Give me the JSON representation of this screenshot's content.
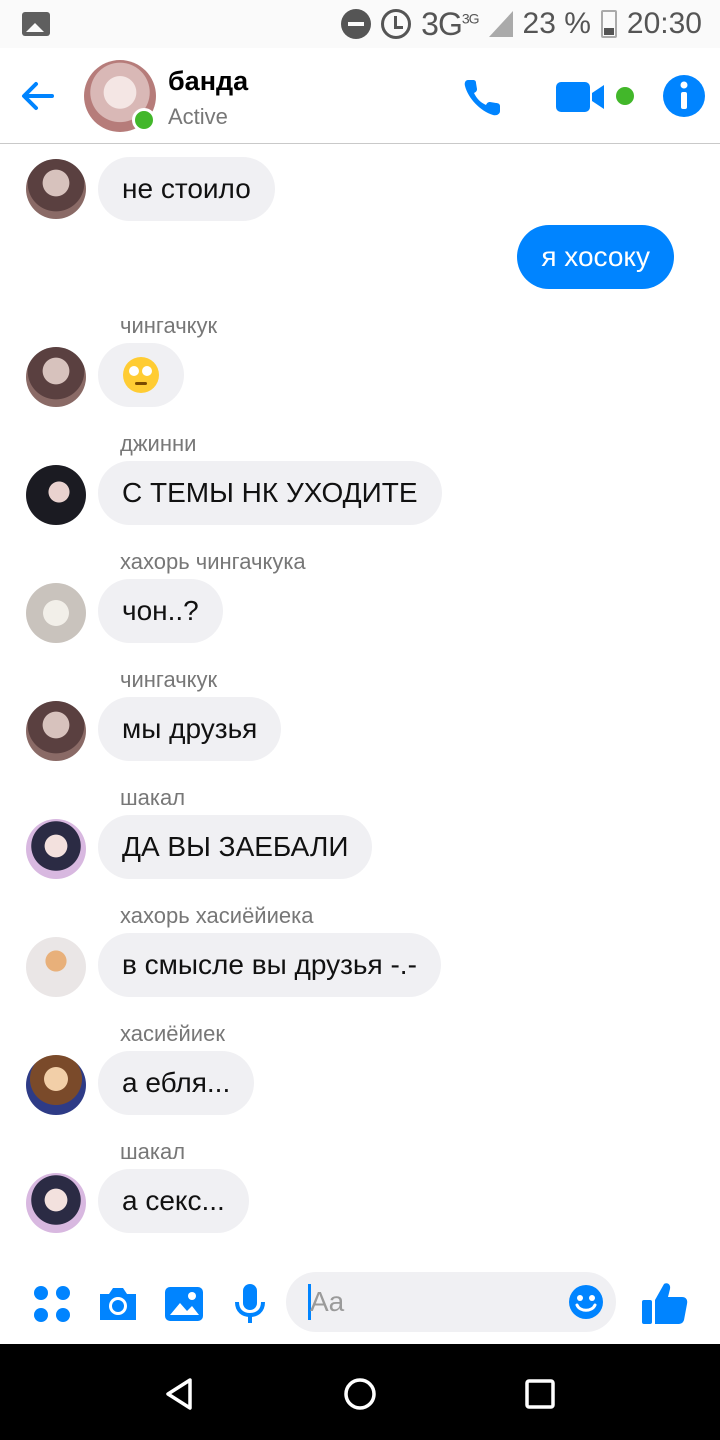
{
  "status_bar": {
    "network": "3G",
    "network_sup": "3G",
    "battery": "23 %",
    "time": "20:30"
  },
  "header": {
    "title": "банда",
    "subtitle": "Active"
  },
  "messages": [
    {
      "type": "incoming",
      "sender": "",
      "text": "не стоило",
      "avatar": "av-a"
    },
    {
      "type": "outgoing",
      "text": "я хосоку"
    },
    {
      "type": "incoming",
      "sender": "чингачкук",
      "text": "",
      "emoji": "face-with-rolling-eyes",
      "avatar": "av-a"
    },
    {
      "type": "incoming",
      "sender": "джинни",
      "text": "С ТЕМЫ НК УХОДИТЕ",
      "avatar": "av-b"
    },
    {
      "type": "incoming",
      "sender": "хахорь чингачкука",
      "text": "чон..?",
      "avatar": "av-c"
    },
    {
      "type": "incoming",
      "sender": "чингачкук",
      "text": "мы друзья",
      "avatar": "av-a"
    },
    {
      "type": "incoming",
      "sender": "шакал",
      "text": "ДА ВЫ ЗАЕБАЛИ",
      "avatar": "av-d"
    },
    {
      "type": "incoming",
      "sender": "хахорь хасиёйиека",
      "text": "в смысле вы друзья -.-",
      "avatar": "av-e"
    },
    {
      "type": "incoming",
      "sender": "хасиёйиек",
      "text": "а ебля...",
      "avatar": "av-f"
    },
    {
      "type": "incoming",
      "sender": "шакал",
      "text": "а секс...",
      "avatar": "av-d"
    }
  ],
  "composer": {
    "placeholder": "Aa"
  },
  "colors": {
    "accent": "#0084ff",
    "active_green": "#42b72a",
    "bubble_gray": "#f0f0f3"
  }
}
